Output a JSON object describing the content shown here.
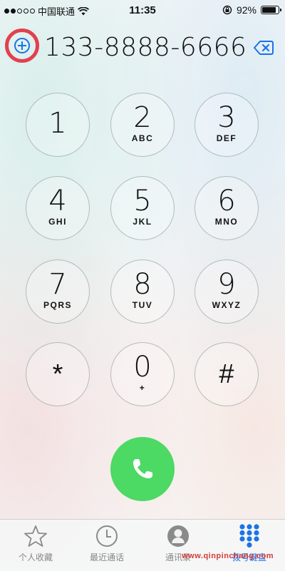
{
  "status_bar": {
    "carrier": "中国联通",
    "time": "11:35",
    "battery_text": "92%",
    "battery_level": 0.92,
    "signal_bars": 2
  },
  "dialer": {
    "number": "133-8888-6666"
  },
  "keypad": {
    "keys": [
      {
        "digit": "1",
        "letters": ""
      },
      {
        "digit": "2",
        "letters": "ABC"
      },
      {
        "digit": "3",
        "letters": "DEF"
      },
      {
        "digit": "4",
        "letters": "GHI"
      },
      {
        "digit": "5",
        "letters": "JKL"
      },
      {
        "digit": "6",
        "letters": "MNO"
      },
      {
        "digit": "7",
        "letters": "PQRS"
      },
      {
        "digit": "8",
        "letters": "TUV"
      },
      {
        "digit": "9",
        "letters": "WXYZ"
      },
      {
        "digit": "*",
        "letters": ""
      },
      {
        "digit": "0",
        "letters": "+"
      },
      {
        "digit": "#",
        "letters": ""
      }
    ]
  },
  "tabs": [
    {
      "label": "个人收藏",
      "icon": "star-icon"
    },
    {
      "label": "最近通话",
      "icon": "clock-icon"
    },
    {
      "label": "通讯录",
      "icon": "contact-icon"
    },
    {
      "label": "拨号键盘",
      "icon": "keypad-icon",
      "active": true
    }
  ],
  "watermark": "www.qinpinchang.com",
  "colors": {
    "call_green": "#4cd964",
    "active_tab": "#1a73e8",
    "highlight_ring": "#e11428"
  }
}
